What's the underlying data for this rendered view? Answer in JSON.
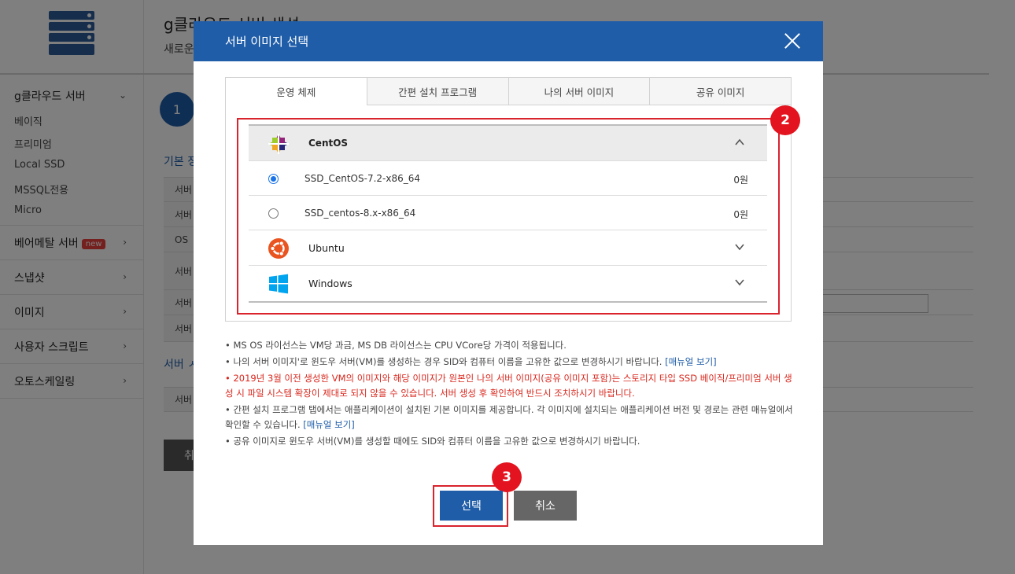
{
  "background": {
    "page_title": "g클라우드 서버 생성",
    "page_subtitle": "새로운",
    "step_number": "1",
    "section_basic": "기본 정",
    "section_server": "서버 ㅅ",
    "row_labels": [
      "서버",
      "서버",
      "OS",
      "서버",
      "서버",
      "서버"
    ],
    "bottom_row_label": "서버",
    "back_button": "취",
    "sidebar": {
      "groups": [
        {
          "label": "g클라우드 서버",
          "expanded": true,
          "items": [
            "베이직",
            "프리미엄",
            "Local SSD",
            "MSSQL전용",
            "Micro"
          ]
        },
        {
          "label": "베어메탈 서버",
          "badge": "new"
        },
        {
          "label": "스냅샷"
        },
        {
          "label": "이미지"
        },
        {
          "label": "사용자 스크립트"
        },
        {
          "label": "오토스케일링"
        }
      ]
    }
  },
  "modal": {
    "title": "서버 이미지 선택",
    "close_icon": "close-icon",
    "tabs": [
      "운영 체제",
      "간편 설치 프로그램",
      "나의 서버 이미지",
      "공유 이미지"
    ],
    "active_tab": 0,
    "os_groups": [
      {
        "name": "CentOS",
        "icon": "centos-logo-icon",
        "expanded": true,
        "images": [
          {
            "name": "SSD_CentOS-7.2-x86_64",
            "price": "0원",
            "selected": true
          },
          {
            "name": "SSD_centos-8.x-x86_64",
            "price": "0원",
            "selected": false
          }
        ]
      },
      {
        "name": "Ubuntu",
        "icon": "ubuntu-logo-icon",
        "expanded": false
      },
      {
        "name": "Windows",
        "icon": "windows-logo-icon",
        "expanded": false
      }
    ],
    "notes": [
      {
        "text": "• MS OS 라이선스는 VM당 과금, MS DB 라이선스는 CPU VCore당 가격이 적용됩니다."
      },
      {
        "text": "• 나의 서버 이미지'로 윈도우 서버(VM)를 생성하는 경우 SID와 컴퓨터 이름을 고유한 값으로 변경하시기 바랍니다. ",
        "link": "[매뉴얼 보기]"
      },
      {
        "text": "• 2019년 3월 이전 생성한 VM의 이미지와 해당 이미지가 원본인 나의 서버 이미지(공유 이미지 포함)는 스토리지 타입 SSD 베이직/프리미엄 서버 생성 시 파일 시스템 확장이 제대로 되지 않을 수 있습니다. 서버 생성 후 확인하여 반드시 조치하시기 바랍니다.",
        "warning": true
      },
      {
        "text": "• 간편 설치 프로그램 탭에서는 애플리케이션이 설치된 기본 이미지를 제공합니다. 각 이미지에 설치되는 애플리케이션 버전 및 경로는 관련 매뉴얼에서 확인할 수 있습니다. ",
        "link": "[매뉴얼 보기]"
      },
      {
        "text": "• 공유 이미지로 윈도우 서버(VM)를 생성할 때에도 SID와 컴퓨터 이름을 고유한 값으로 변경하시기 바랍니다."
      }
    ],
    "buttons": {
      "select": "선택",
      "cancel": "취소"
    }
  },
  "annotations": {
    "marker_list": "2",
    "marker_button": "3",
    "accent_color": "#d9232d"
  },
  "colors": {
    "primary": "#1f5da8",
    "warning": "#d9261c"
  }
}
